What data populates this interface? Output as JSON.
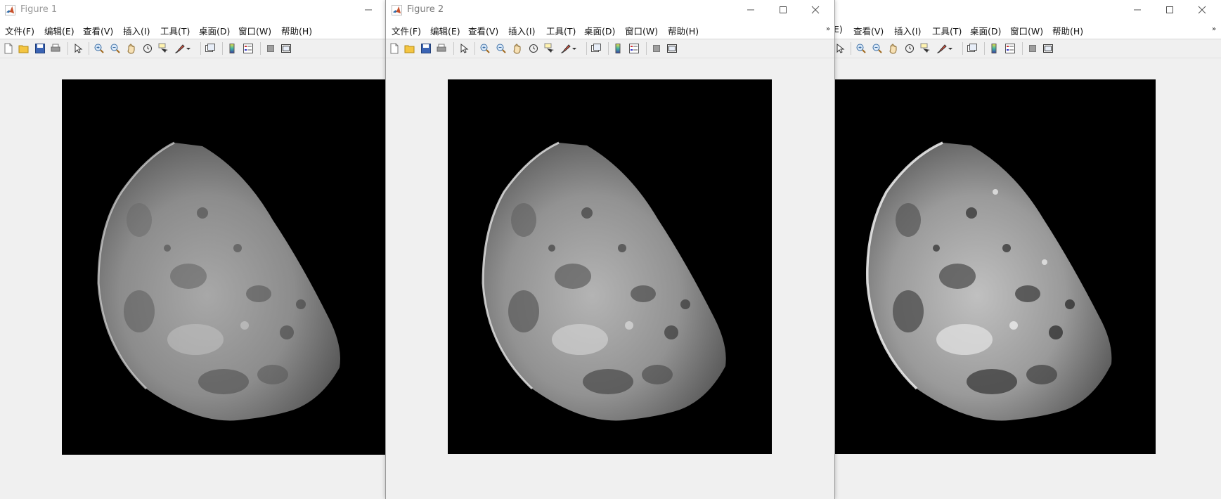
{
  "figures": [
    {
      "title": "Figure 1",
      "controls": [
        "minimize-icon"
      ],
      "menus": [
        "文件(F)",
        "编辑(E)",
        "查看(V)",
        "插入(I)",
        "工具(T)",
        "桌面(D)",
        "窗口(W)",
        "帮助(H)"
      ],
      "image_variant": "original grayscale moon"
    },
    {
      "title": "Figure 2",
      "controls": [
        "minimize-icon",
        "maximize-icon",
        "close-icon"
      ],
      "menus": [
        "文件(F)",
        "编辑(E)",
        "查看(V)",
        "插入(I)",
        "工具(T)",
        "桌面(D)",
        "窗口(W)",
        "帮助(H)"
      ],
      "menu_overflow": "»",
      "image_variant": "sharpened grayscale moon"
    },
    {
      "title": "",
      "controls": [
        "minimize-icon",
        "maximize-icon",
        "close-icon"
      ],
      "menus": [
        "E)",
        "查看(V)",
        "插入(I)",
        "工具(T)",
        "桌面(D)",
        "窗口(W)",
        "帮助(H)"
      ],
      "menu_overflow": "»",
      "image_variant": "strongly sharpened grayscale moon"
    }
  ],
  "toolbar_icons": [
    "new-figure-icon",
    "open-file-icon",
    "save-icon",
    "print-icon",
    "select-arrow-icon",
    "zoom-in-icon",
    "zoom-out-icon",
    "pan-hand-icon",
    "rotate-3d-icon",
    "data-cursor-icon",
    "brush-icon",
    "link-plot-icon",
    "colorbar-icon",
    "legend-icon",
    "hide-plot-tools-icon",
    "show-plot-tools-icon"
  ]
}
